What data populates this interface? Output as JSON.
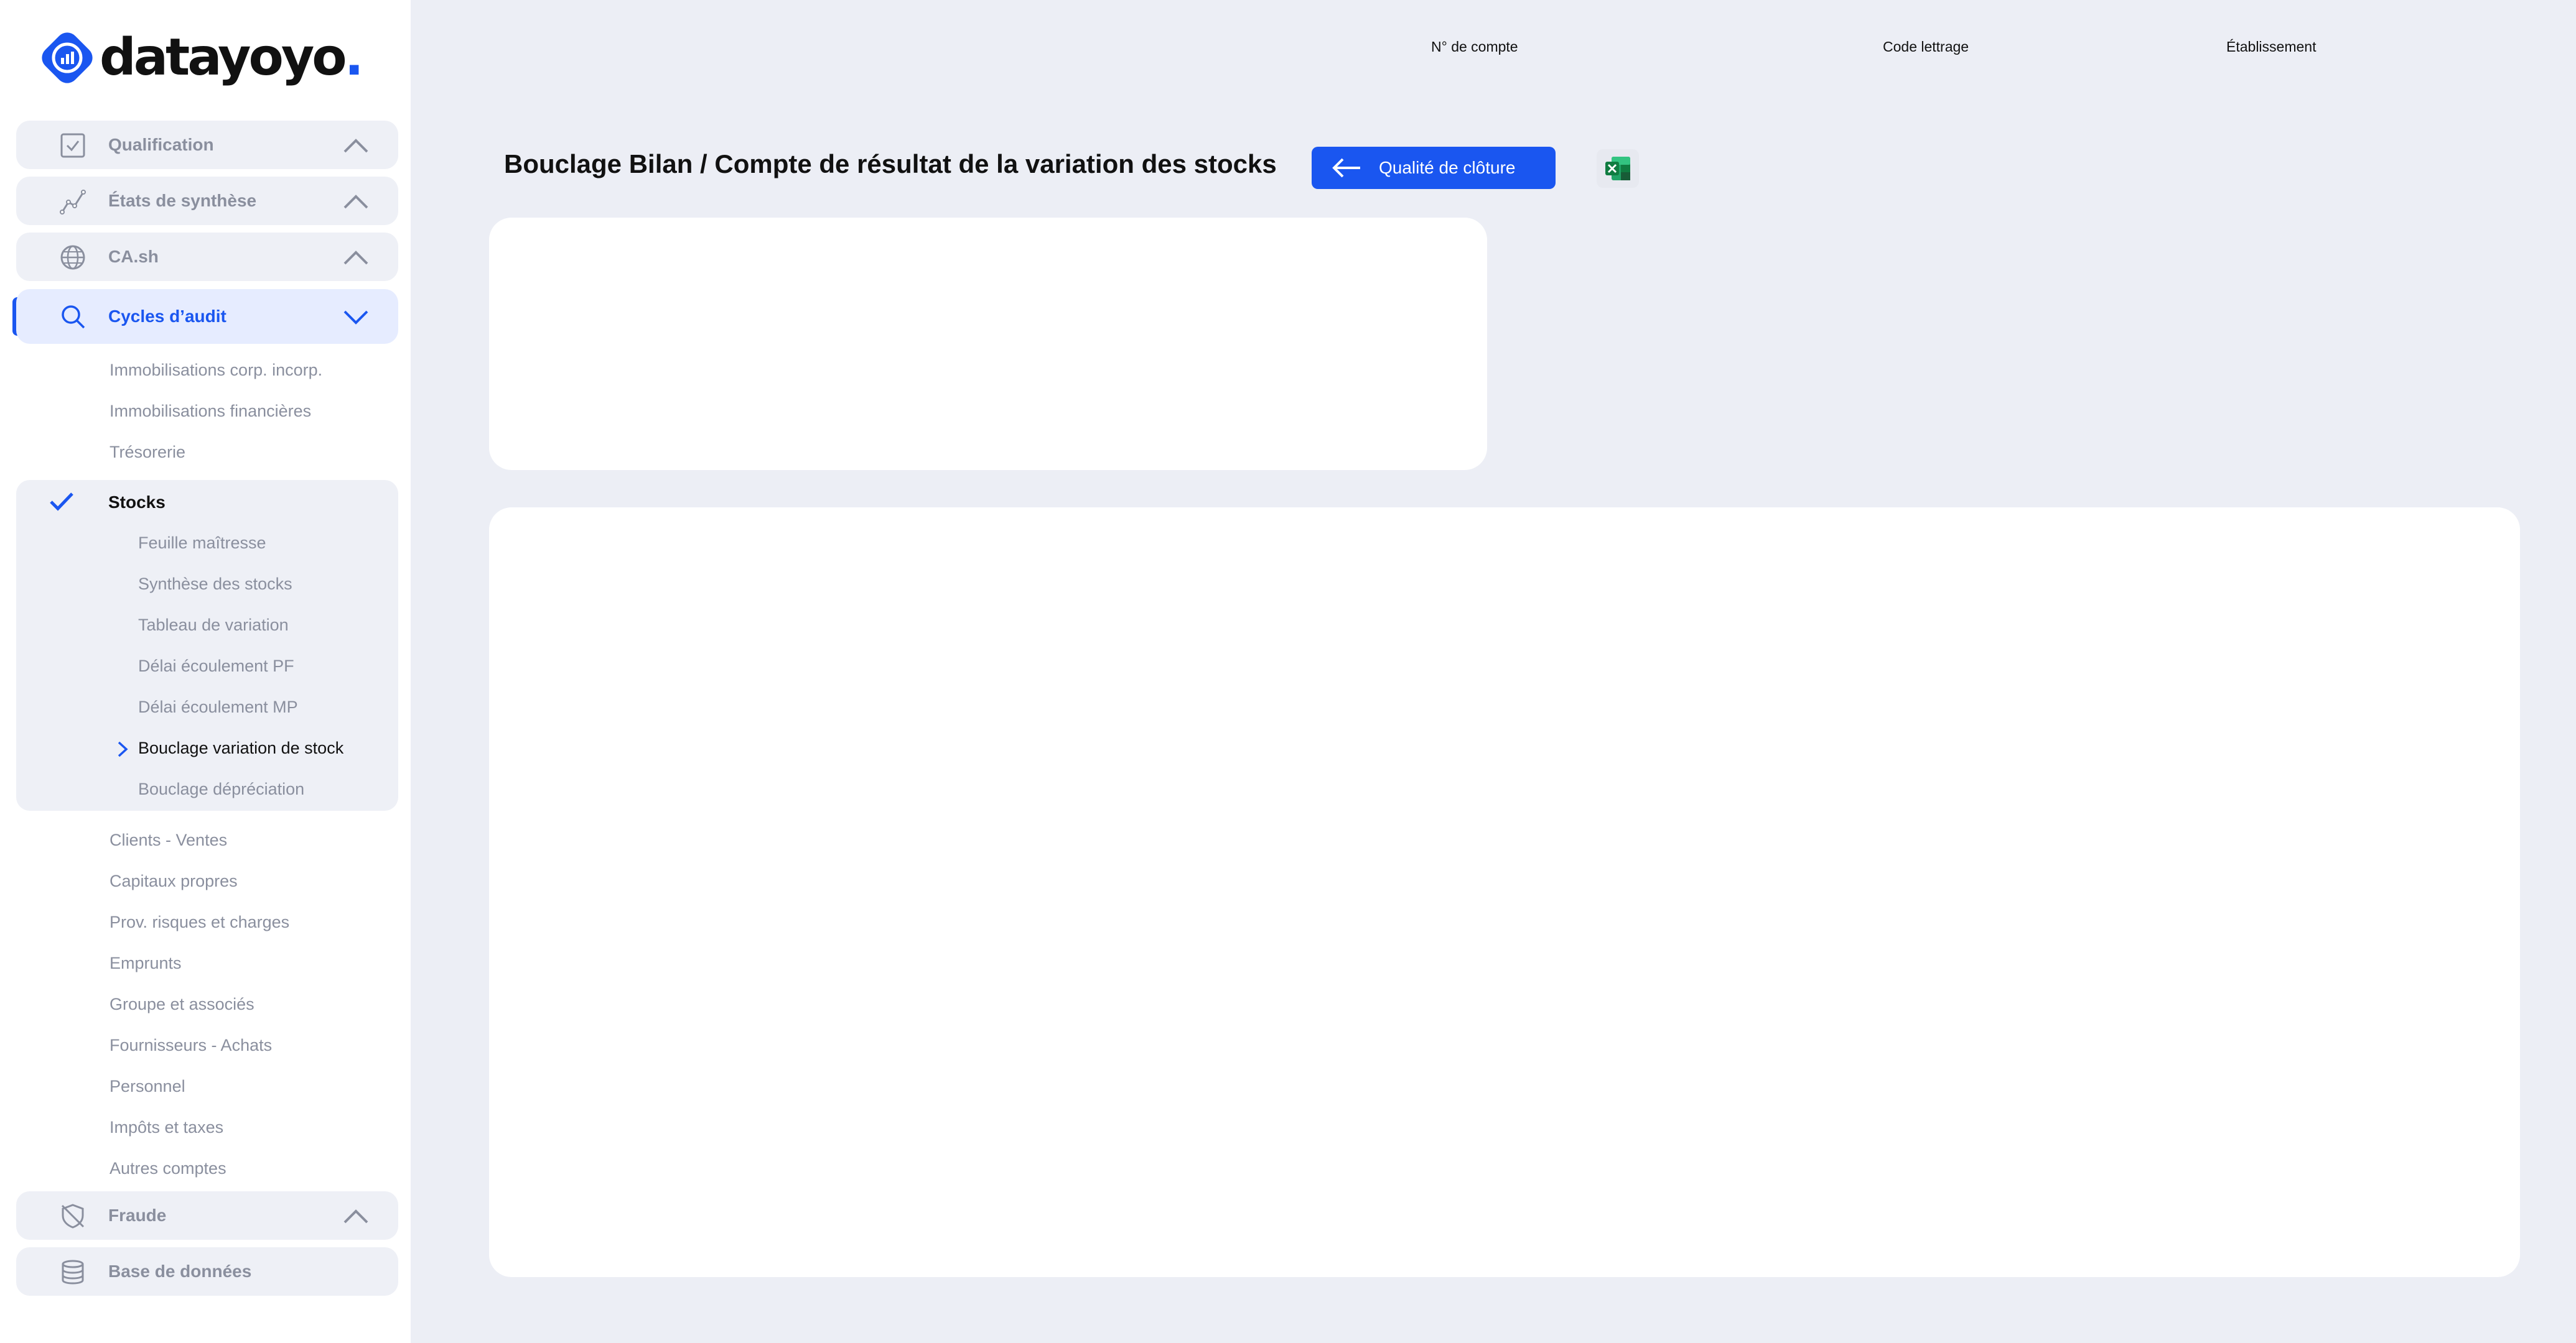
{
  "app": {
    "logo_text": "datayoyo",
    "logo_dot": ".",
    "brand_color": "#1a56f0"
  },
  "sidebar": {
    "groups": [
      {
        "label": "Qualification",
        "icon": "checkbox-icon",
        "expanded": false
      },
      {
        "label": "États de synthèse",
        "icon": "chart-line-icon",
        "expanded": false
      },
      {
        "label": "CA.sh",
        "icon": "globe-icon",
        "expanded": false
      },
      {
        "label": "Cycles d’audit",
        "icon": "search-icon",
        "expanded": true,
        "active": true
      }
    ],
    "audit_items_before": [
      "Immobilisations corp. incorp.",
      "Immobilisations financières",
      "Trésorerie"
    ],
    "stocks": {
      "label": "Stocks",
      "items": [
        "Feuille maîtresse",
        "Synthèse des stocks",
        "Tableau de variation",
        "Délai écoulement PF",
        "Délai écoulement MP",
        "Bouclage variation de stock",
        "Bouclage dépréciation"
      ],
      "current": "Bouclage variation de stock"
    },
    "audit_items_after": [
      "Clients - Ventes",
      "Capitaux propres",
      "Prov. risques et charges",
      "Emprunts",
      "Groupe et associés",
      "Fournisseurs - Achats",
      "Personnel",
      "Impôts et taxes",
      "Autres comptes"
    ],
    "bottom_groups": [
      {
        "label": "Fraude",
        "icon": "shield-off-icon",
        "expanded": false
      },
      {
        "label": "Base de données",
        "icon": "database-icon"
      }
    ]
  },
  "header": {
    "fields": [
      "N° de compte",
      "Code lettrage",
      "Établissement"
    ]
  },
  "main": {
    "title": "Bouclage Bilan / Compte de résultat de la variation des stocks",
    "back_button": "Qualité de clôture",
    "export_icon": "excel-icon"
  }
}
